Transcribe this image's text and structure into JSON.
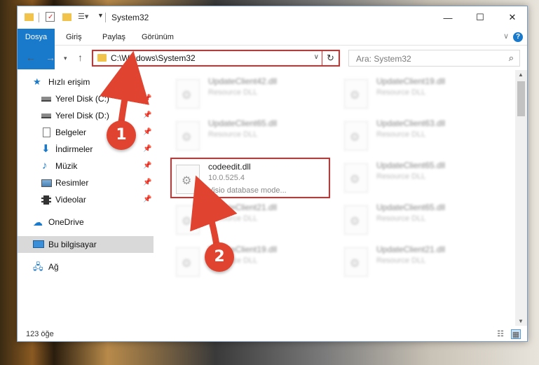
{
  "window": {
    "title": "System32"
  },
  "ribbon": {
    "tabs": [
      "Dosya",
      "Giriş",
      "Paylaş",
      "Görünüm"
    ],
    "help_label": "?"
  },
  "nav": {
    "address": "C:\\Windows\\System32",
    "search_placeholder": "Ara: System32"
  },
  "sidebar": {
    "quick_access": "Hızlı erişim",
    "items": [
      {
        "label": "Yerel Disk (C:)",
        "icon": "drive-icon"
      },
      {
        "label": "Yerel Disk (D:)",
        "icon": "drive-icon"
      },
      {
        "label": "Belgeler",
        "icon": "documents-icon"
      },
      {
        "label": "İndirmeler",
        "icon": "download-icon"
      },
      {
        "label": "Müzik",
        "icon": "music-icon"
      },
      {
        "label": "Resimler",
        "icon": "pictures-icon"
      },
      {
        "label": "Videolar",
        "icon": "videos-icon"
      }
    ],
    "onedrive": "OneDrive",
    "this_pc": "Bu bilgisayar",
    "network": "Ağ"
  },
  "files": {
    "left": [
      {
        "name": "UpdateClient42.dll",
        "desc": "Resource DLL"
      },
      {
        "name": "UpdateClient65.dll",
        "desc": "Resource DLL"
      },
      {
        "name": "codeedit.dll",
        "desc": "10.0.525.4",
        "desc2": "Visio database mode..."
      },
      {
        "name": "UpdateClient21.dll",
        "desc": "Resource DLL"
      },
      {
        "name": "UpdateClient19.dll",
        "desc": "Resource DLL"
      }
    ],
    "right": [
      {
        "name": "UpdateClient19.dll",
        "desc": "Resource DLL"
      },
      {
        "name": "UpdateClient63.dll",
        "desc": "Resource DLL"
      },
      {
        "name": "UpdateClient65.dll",
        "desc": "Resource DLL"
      },
      {
        "name": "UpdateClient65.dll",
        "desc": "Resource DLL"
      },
      {
        "name": "UpdateClient21.dll",
        "desc": "Resource DLL"
      }
    ]
  },
  "status": {
    "count": "123 öğe"
  },
  "annotations": {
    "step1": "1",
    "step2": "2",
    "color": "#e0432f"
  },
  "colors": {
    "accent": "#1979ca",
    "highlight": "#d62d2d"
  }
}
